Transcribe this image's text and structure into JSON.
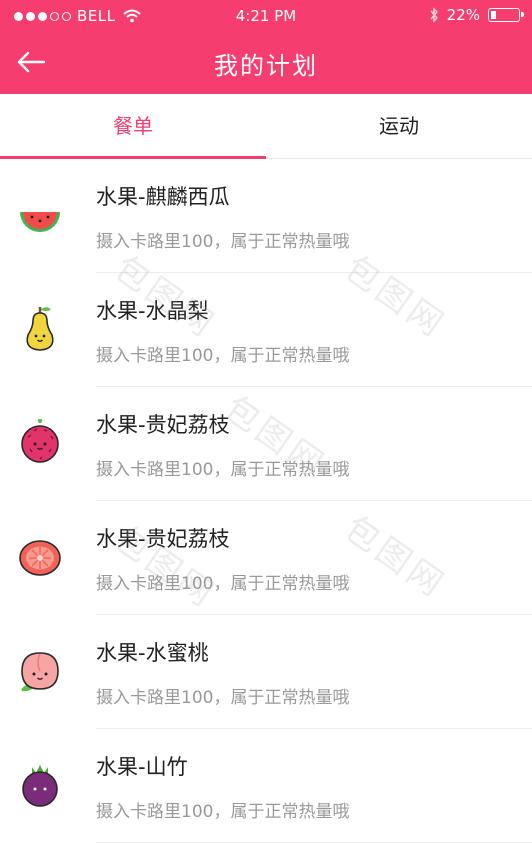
{
  "status_bar": {
    "carrier": "BELL",
    "time": "4:21 PM",
    "battery": "22%",
    "battery_level": 0.22,
    "signal_filled": 3,
    "signal_total": 5
  },
  "nav": {
    "title": "我的计划",
    "back_icon": "arrow-left-icon"
  },
  "tabs": [
    {
      "label": "餐单",
      "active": true
    },
    {
      "label": "运动",
      "active": false
    }
  ],
  "items": [
    {
      "name": "水果-麒麟西瓜",
      "desc": "摄入卡路里100，属于正常热量哦",
      "icon": "watermelon-icon"
    },
    {
      "name": "水果-水晶梨",
      "desc": "摄入卡路里100，属于正常热量哦",
      "icon": "pear-icon"
    },
    {
      "name": "水果-贵妃荔枝",
      "desc": "摄入卡路里100，属于正常热量哦",
      "icon": "lychee-icon"
    },
    {
      "name": "水果-贵妃荔枝",
      "desc": "摄入卡路里100，属于正常热量哦",
      "icon": "grapefruit-icon"
    },
    {
      "name": "水果-水蜜桃",
      "desc": "摄入卡路里100，属于正常热量哦",
      "icon": "peach-icon"
    },
    {
      "name": "水果-山竹",
      "desc": "摄入卡路里100，属于正常热量哦",
      "icon": "mangosteen-icon"
    }
  ],
  "watermark": "包图网",
  "colors": {
    "accent": "#f53d6f",
    "text": "#222222",
    "subtext": "#999999"
  }
}
